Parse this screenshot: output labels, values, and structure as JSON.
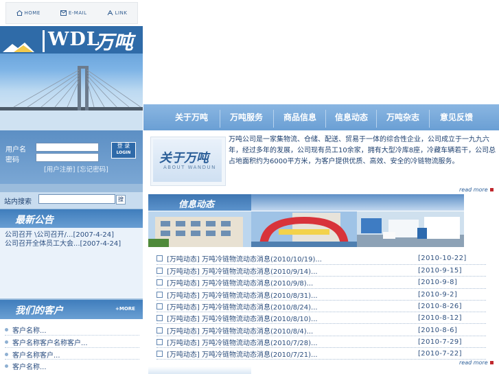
{
  "top_links": [
    {
      "label": "HOME",
      "icon": "home-icon"
    },
    {
      "label": "E-MAIL",
      "icon": "mail-icon"
    },
    {
      "label": "LINK",
      "icon": "link-icon"
    }
  ],
  "logo": {
    "latin": "WDL",
    "cn": "万吨"
  },
  "login": {
    "user_label": "用户名",
    "pass_label": "密码",
    "button_top": "登 录",
    "button_bottom": "LOGIN",
    "register": "[用户注册]",
    "forgot": "[忘记密码]"
  },
  "search": {
    "label": "站内搜索",
    "button": "搜"
  },
  "notice": {
    "heading": "最新公告",
    "items": [
      {
        "text": "公司召开 \\公司召开/...",
        "date": "[2007-4-24]"
      },
      {
        "text": "公司召开全体员工大会...",
        "date": "[2007-4-24]"
      }
    ]
  },
  "clients": {
    "heading": "我们的客户",
    "more": "+MORE",
    "items": [
      "客户名称...",
      "客户名称客户名称客户...",
      "客户名称客户...",
      "客户名称..."
    ]
  },
  "nav": [
    "关于万吨",
    "万吨服务",
    "商品信息",
    "信息动态",
    "万吨杂志",
    "意见反馈"
  ],
  "about": {
    "title": "关于万吨",
    "subtitle": "ABOUT WANDUN",
    "text": "万吨公司是一家集物流、仓储、配送、贸易于一体的综合性企业，公司成立于一九九六年，经过多年的发展，公司现有员工10余家，拥有大型冷库8座，冷藏车辆若干，公司总占地面积约为6000平方米，为客户提供优质、高效、安全的冷链物流服务。",
    "read_more": "read more"
  },
  "news": {
    "heading": "信息动态",
    "read_more": "read more",
    "items": [
      {
        "text": "[万吨动态] 万吨冷链物流动态消息(2010/10/19)...",
        "date": "[2010-10-22]"
      },
      {
        "text": "[万吨动态] 万吨冷链物流动态消息(2010/9/14)...",
        "date": "[2010-9-15]"
      },
      {
        "text": "[万吨动态] 万吨冷链物流动态消息(2010/9/8)...",
        "date": "[2010-9-8]"
      },
      {
        "text": "[万吨动态] 万吨冷链物流动态消息(2010/8/31)...",
        "date": "[2010-9-2]"
      },
      {
        "text": "[万吨动态] 万吨冷链物流动态消息(2010/8/24)...",
        "date": "[2010-8-26]"
      },
      {
        "text": "[万吨动态] 万吨冷链物流动态消息(2010/8/10)...",
        "date": "[2010-8-12]"
      },
      {
        "text": "[万吨动态] 万吨冷链物流动态消息(2010/8/4)...",
        "date": "[2010-8-6]"
      },
      {
        "text": "[万吨动态] 万吨冷链物流动态消息(2010/7/28)...",
        "date": "[2010-7-29]"
      },
      {
        "text": "[万吨动态] 万吨冷链物流动态消息(2010/7/21)...",
        "date": "[2010-7-22]"
      }
    ]
  },
  "colors": {
    "accent": "#3d75b1",
    "nav": "#7aabdb",
    "alert": "#c0272d"
  }
}
